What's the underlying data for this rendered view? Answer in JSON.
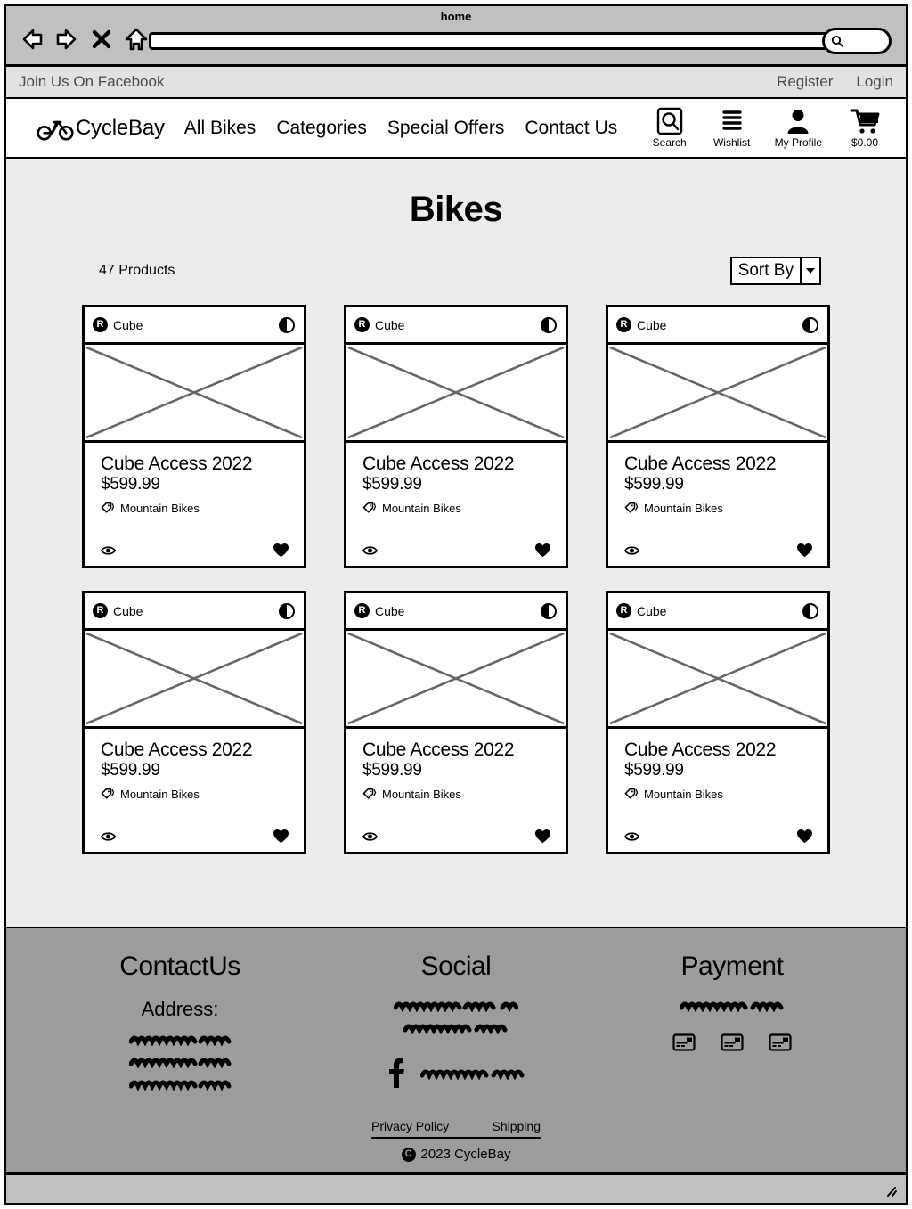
{
  "browser": {
    "title": "home",
    "url_value": "",
    "url_placeholder": "",
    "search_value": "",
    "search_placeholder": "",
    "controls": [
      {
        "name": "back-icon",
        "label": "Back"
      },
      {
        "name": "forward-icon",
        "label": "Forward"
      },
      {
        "name": "stop-icon",
        "label": "Stop"
      },
      {
        "name": "home-icon",
        "label": "Home"
      }
    ]
  },
  "utility_bar": {
    "facebook_text": "Join Us On Facebook",
    "register": "Register",
    "login": "Login"
  },
  "navbar": {
    "brand": "CycleBay",
    "brand_icon": "bicycle-icon",
    "links": [
      {
        "label": "All Bikes"
      },
      {
        "label": "Categories"
      },
      {
        "label": "Special Offers"
      },
      {
        "label": "Contact Us"
      }
    ],
    "actions": [
      {
        "icon": "search-icon",
        "label": "Search"
      },
      {
        "icon": "list-icon",
        "label": "Wishlist"
      },
      {
        "icon": "person-icon",
        "label": "My Profile"
      },
      {
        "icon": "cart-icon",
        "label": "$0.00"
      }
    ]
  },
  "page": {
    "title": "Bikes",
    "product_count": "47 Products",
    "sort_by_label": "Sort By",
    "sort_by_icon": "chevron-down-icon"
  },
  "products": [
    {
      "brand": "Cube",
      "badge": "R",
      "title": "Cube Access 2022",
      "price": "$599.99",
      "category": "Mountain Bikes"
    },
    {
      "brand": "Cube",
      "badge": "R",
      "title": "Cube Access 2022",
      "price": "$599.99",
      "category": "Mountain Bikes"
    },
    {
      "brand": "Cube",
      "badge": "R",
      "title": "Cube Access 2022",
      "price": "$599.99",
      "category": "Mountain Bikes"
    },
    {
      "brand": "Cube",
      "badge": "R",
      "title": "Cube Access 2022",
      "price": "$599.99",
      "category": "Mountain Bikes"
    },
    {
      "brand": "Cube",
      "badge": "R",
      "title": "Cube Access 2022",
      "price": "$599.99",
      "category": "Mountain Bikes"
    },
    {
      "brand": "Cube",
      "badge": "R",
      "title": "Cube Access 2022",
      "price": "$599.99",
      "category": "Mountain Bikes"
    }
  ],
  "footer": {
    "contact_heading": "ContactUs",
    "address_label": "Address:",
    "address_lines": [
      "scribble",
      "scribble",
      "scribble"
    ],
    "social_heading": "Social",
    "social_lines": [
      "scribble",
      "scribble"
    ],
    "social_facebook_line": "scribble",
    "payment_heading": "Payment",
    "payment_line": "scribble",
    "payment_icons": [
      "card-icon",
      "card-icon",
      "card-icon"
    ],
    "links": [
      {
        "label": "Privacy Policy"
      },
      {
        "label": "Shipping"
      }
    ],
    "copyright_mark": "C",
    "copyright": "2023 CycleBay"
  },
  "colors": {
    "chrome": "#c0c0c0",
    "utility_bar": "#e2e2e2",
    "page_bg": "#ececec",
    "footer_bg": "#9c9c9c",
    "ink": "#000000",
    "placeholder_stroke": "#666666"
  }
}
